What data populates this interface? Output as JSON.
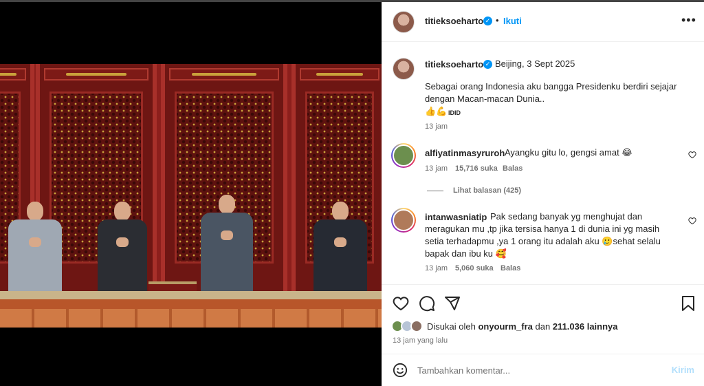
{
  "post": {
    "username": "titieksoeharto",
    "follow_label": "Ikuti",
    "more_label": "•••",
    "location_date": "Beijing, 3 Sept 2025",
    "caption_line1": "Sebagai orang Indonesia aku bangga Presidenku berdiri sejajar",
    "caption_line2": "dengan Macan-macan Dunia..",
    "caption_emoji": "👍💪",
    "caption_tag": "IDID",
    "caption_time": "13 jam"
  },
  "comments": [
    {
      "username": "alfiyatinmasyruroh",
      "text": "Ayangku gitu lo, gengsi amat 😂",
      "time": "13 jam",
      "likes": "15,716 suka",
      "reply_label": "Balas",
      "view_replies": "Lihat balasan (425)"
    },
    {
      "username": "intanwasniatip",
      "text_line1": "Pak sedang banyak yg menghujat dan",
      "text_line2": "meragukan mu ,tp jika tersisa hanya 1 di dunia ini yg masih",
      "text_line3": "setia terhadapmu ,ya 1 orang itu adalah aku 🥲sehat selalu",
      "text_line4": "bapak dan ibu ku 🥰",
      "time": "13 jam",
      "likes": "5,060 suka",
      "reply_label": "Balas"
    }
  ],
  "engagement": {
    "liked_by_prefix": "Disukai oleh ",
    "liked_by_user": "onyourm_fra",
    "liked_by_suffix": " dan ",
    "liked_by_count": "211.036 lainnya",
    "time_ago": "13 jam yang lalu"
  },
  "comment_form": {
    "placeholder": "Tambahkan komentar...",
    "post_label": "Kirim"
  },
  "icons": {
    "like": "heart-icon",
    "comment": "comment-icon",
    "share": "share-icon",
    "save": "bookmark-icon",
    "emoji": "emoji-icon",
    "comment_like": "heart-icon"
  },
  "colors": {
    "accent": "#0095f6",
    "post_button_disabled": "#b2dffc",
    "muted": "#737373"
  }
}
